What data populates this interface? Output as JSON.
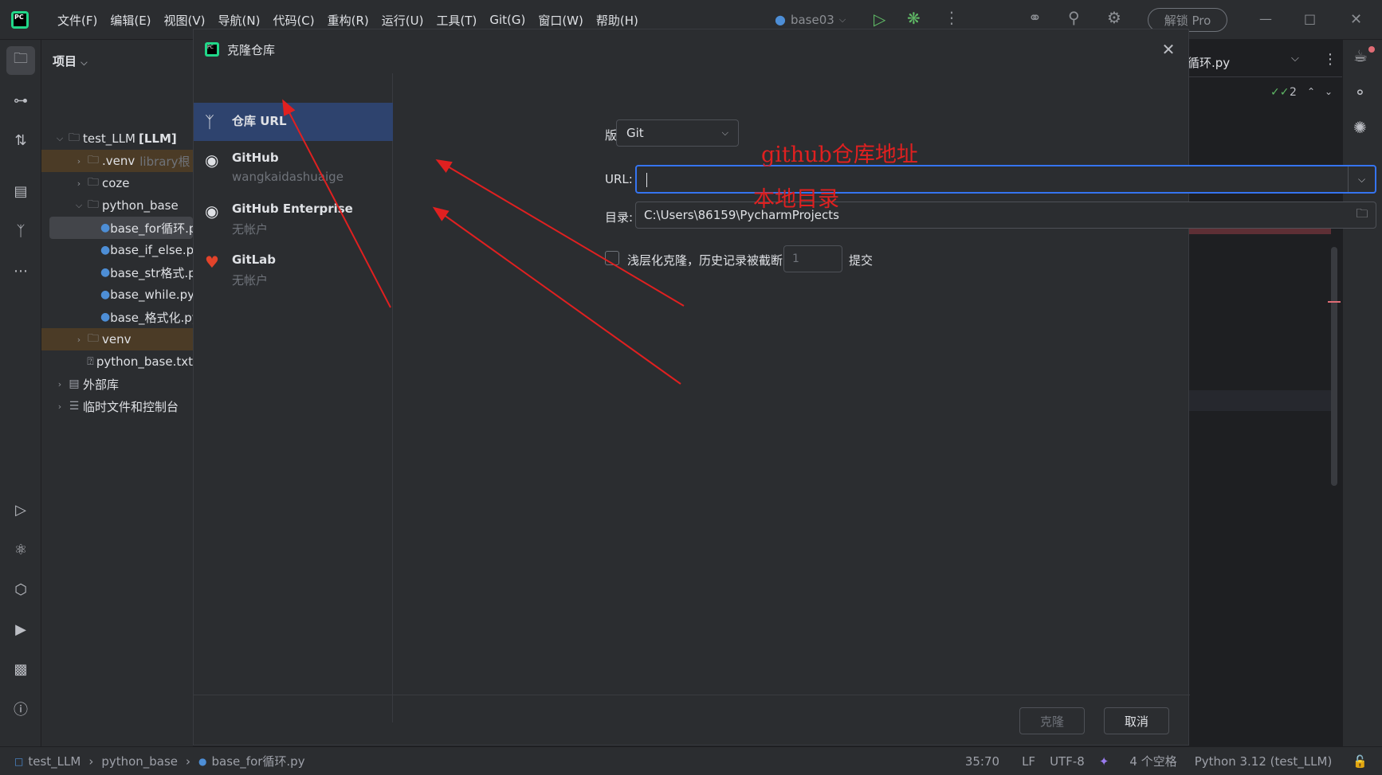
{
  "menu": [
    "文件(F)",
    "编辑(E)",
    "视图(V)",
    "导航(N)",
    "代码(C)",
    "重构(R)",
    "运行(U)",
    "工具(T)",
    "Git(G)",
    "窗口(W)",
    "帮助(H)"
  ],
  "app_logo": "PC",
  "run_config": "base03",
  "pro_label": "解锁 Pro",
  "project": {
    "header": "项目",
    "tree": [
      {
        "label": "test_LLM",
        "extra": "[LLM]"
      },
      {
        "label": ".venv",
        "extra": "library根"
      },
      {
        "label": "coze"
      },
      {
        "label": "python_base"
      },
      {
        "label": "base_for循环.py"
      },
      {
        "label": "base_if_else.py"
      },
      {
        "label": "base_str格式.py"
      },
      {
        "label": "base_while.py"
      },
      {
        "label": "base_格式化.py"
      },
      {
        "label": "venv"
      },
      {
        "label": "python_base.txt"
      },
      {
        "label": "外部库"
      },
      {
        "label": "临时文件和控制台"
      }
    ]
  },
  "editor": {
    "tab_name": "循环.py",
    "inspection_count": "2"
  },
  "dialog": {
    "logo": "PC",
    "title": "克隆仓库",
    "providers": [
      {
        "name": "仓库 URL",
        "sub": ""
      },
      {
        "name": "GitHub",
        "sub": "wangkaidashuaige"
      },
      {
        "name": "GitHub Enterprise",
        "sub": "无帐户"
      },
      {
        "name": "GitLab",
        "sub": "无帐户"
      }
    ],
    "vcs_label": "版本控制:",
    "vcs_value": "Git",
    "url_label": "URL:",
    "url_value": "",
    "dir_label": "目录:",
    "dir_value": "C:\\Users\\86159\\PycharmProjects",
    "shallow_label": "浅层化克隆，历史记录被截断为",
    "shallow_depth": "1",
    "shallow_suffix": "提交",
    "clone_button": "克隆",
    "cancel_button": "取消"
  },
  "annotations": {
    "url_note": "github仓库地址",
    "dir_note": "本地目录",
    "color": "#e02020"
  },
  "status": {
    "breadcrumb": [
      "test_LLM",
      "python_base",
      "base_for循环.py"
    ],
    "position": "35:70",
    "line_sep": "LF",
    "encoding": "UTF-8",
    "indent": "4 个空格",
    "interpreter": "Python 3.12 (test_LLM)"
  },
  "colors": {
    "accent": "#3574f0",
    "selected_provider": "#2e436e",
    "excluded_folder": "#4b3b26",
    "run_green": "#5fb865"
  }
}
